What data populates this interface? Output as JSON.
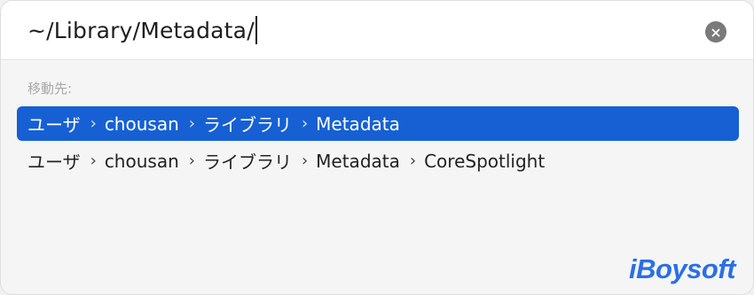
{
  "search": {
    "value": "~/Library/Metadata/"
  },
  "clear_button": {
    "icon": "xmark-circle-icon"
  },
  "results": {
    "section_label": "移動先:",
    "items": [
      {
        "selected": true,
        "crumbs": [
          "ユーザ",
          "chousan",
          "ライブラリ",
          "Metadata"
        ]
      },
      {
        "selected": false,
        "crumbs": [
          "ユーザ",
          "chousan",
          "ライブラリ",
          "Metadata",
          "CoreSpotlight"
        ]
      }
    ],
    "separator": "›"
  },
  "watermark": {
    "text": "iBoysoft"
  },
  "colors": {
    "selection": "#1660d4",
    "watermark": "#2a6fe6",
    "clear_button": "#7a7a7a"
  }
}
